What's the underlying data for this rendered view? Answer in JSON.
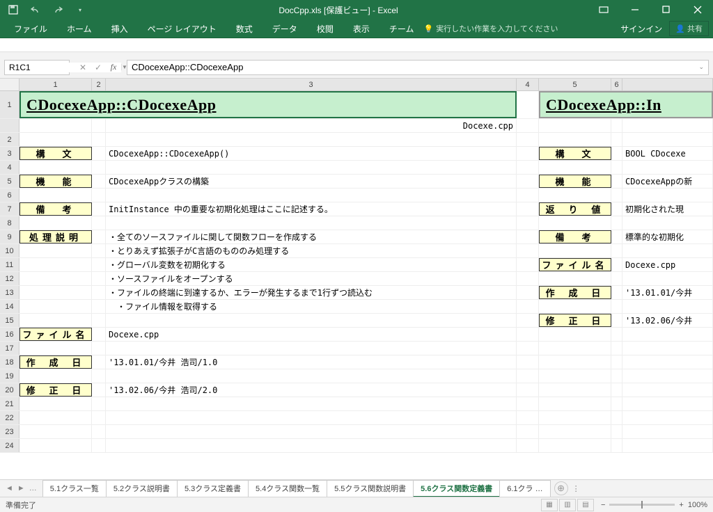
{
  "title": "DocCpp.xls [保護ビュー] - Excel",
  "qat": {
    "save": "save-icon",
    "undo": "undo-icon",
    "redo": "redo-icon"
  },
  "window": {
    "restore_small": "restore-small-icon"
  },
  "ribbon": {
    "tabs": [
      "ファイル",
      "ホーム",
      "挿入",
      "ページ レイアウト",
      "数式",
      "データ",
      "校閲",
      "表示",
      "チーム"
    ],
    "tellme": "実行したい作業を入力してください",
    "signin": "サインイン",
    "share": "共有"
  },
  "namebox": "R1C1",
  "formula": "CDocexeApp::CDocexeApp",
  "cols": [
    "1",
    "2",
    "3",
    "4",
    "5",
    "6"
  ],
  "rows": [
    {
      "n": "1",
      "h": "40",
      "c1_title": "CDocexeApp::CDocexeApp",
      "c5_title": "CDocexeApp::In"
    },
    {
      "n": "",
      "c3": "Docexe.cpp",
      "align": "right"
    },
    {
      "n": "2"
    },
    {
      "n": "3",
      "label1": "構　文",
      "c3": "CDocexeApp::CDocexeApp()",
      "label5": "構　文",
      "c7": "BOOL CDocexe"
    },
    {
      "n": "4"
    },
    {
      "n": "5",
      "label1": "機　能",
      "c3": "CDocexeAppクラスの構築",
      "label5": "機　能",
      "c7": "CDocexeAppの新"
    },
    {
      "n": "6"
    },
    {
      "n": "7",
      "label1": "備　考",
      "c3": "InitInstance 中の重要な初期化処理はここに記述する。",
      "label5": "返 り 値",
      "c7": "初期化された現"
    },
    {
      "n": "8"
    },
    {
      "n": "9",
      "label1": "処理説明",
      "c3": "・全てのソースファイルに関して関数フローを作成する",
      "label5": "備　考",
      "c7": "標準的な初期化"
    },
    {
      "n": "10",
      "c3": "・とりあえず拡張子がC言語のもののみ処理する"
    },
    {
      "n": "11",
      "c3": "・グローバル変数を初期化する",
      "label5": "ファイル名",
      "c7": "Docexe.cpp"
    },
    {
      "n": "12",
      "c3": "・ソースファイルをオープンする"
    },
    {
      "n": "13",
      "c3": "・ファイルの終端に到達するか、エラーが発生するまで1行ずつ読込む",
      "label5": "作 成 日",
      "c7": "'13.01.01/今井"
    },
    {
      "n": "14",
      "c3": "　・ファイル情報を取得する"
    },
    {
      "n": "15",
      "label5": "修 正 日",
      "c7": "'13.02.06/今井"
    },
    {
      "n": "16",
      "label1": "ファイル名",
      "c3": "Docexe.cpp"
    },
    {
      "n": "17"
    },
    {
      "n": "18",
      "label1": "作 成 日",
      "c3": "'13.01.01/今井 浩司/1.0"
    },
    {
      "n": "19"
    },
    {
      "n": "20",
      "label1": "修 正 日",
      "c3": "'13.02.06/今井 浩司/2.0"
    },
    {
      "n": "21"
    },
    {
      "n": "22"
    },
    {
      "n": "23"
    },
    {
      "n": "24"
    }
  ],
  "sheets": {
    "ellipsis": "…",
    "list": [
      "5.1クラス一覧",
      "5.2クラス説明書",
      "5.3クラス定義書",
      "5.4クラス関数一覧",
      "5.5クラス関数説明書",
      "5.6クラス関数定義書",
      "6.1クラ …"
    ],
    "active": 5
  },
  "status": {
    "ready": "準備完了",
    "zoom": "100%"
  }
}
